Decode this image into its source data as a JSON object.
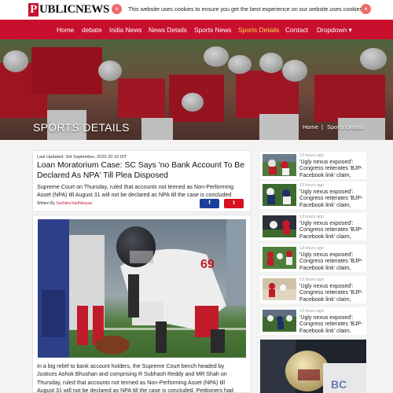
{
  "brand": {
    "logo_initial": "P",
    "logo_rest": "UBLICNEWS"
  },
  "cookie": {
    "close_left": "×",
    "text": "This website uses cookies to ensure you get the best experience on our website.uses cookies",
    "close_right": "×"
  },
  "nav": {
    "items": [
      "Home",
      "debate",
      "India News",
      "News Details",
      "Sports News",
      "Sports Details",
      "Contact",
      "Dropdown ▾"
    ],
    "active": "Sports Details"
  },
  "hero": {
    "title": "SPORTS DETAILS",
    "breadcrumb_home": "Home",
    "breadcrumb_sep": "|",
    "breadcrumb_current": "Sports Details"
  },
  "article": {
    "updated": "Last Updated: 3rd September, 2020 20:16 IST",
    "headline": "Loan Moratorium Case: SC Says 'no Bank Account To Be Declared As NPA' Till Plea Disposed",
    "summary": "Supreme Court on Thursday, ruled that accounts not termed as Non-Performing Asset (NPA) till August 31 will not be declared as NPA till the case is concluded",
    "written_by": "Written By",
    "author": "Suchitra Karthikeyan",
    "share_facebook": "f",
    "share_twitter": "t",
    "body": "In a big relief to bank account holders, the Supreme Court bench headed by Justices Ashok Bhushan and comprising R Subhash Reddy and MR Shah on Thursday, ruled that accounts not termed as Non-Performing Asset (NPA) till August 31 will not be declared as NPA till the case is concluded. Petitioners had"
  },
  "sidebar": {
    "items": [
      {
        "time": "13 hours ago",
        "title": "'Ugly nexus exposed': Congress reiterates 'BJP-Facebook link' claim,"
      },
      {
        "time": "13 hours ago",
        "title": "'Ugly nexus exposed': Congress reiterates 'BJP-Facebook link' claim,"
      },
      {
        "time": "13 hours ago",
        "title": "'Ugly nexus exposed': Congress reiterates 'BJP-Facebook link' claim,"
      },
      {
        "time": "13 hours ago",
        "title": "'Ugly nexus exposed': Congress reiterates 'BJP-Facebook link' claim,"
      },
      {
        "time": "13 hours ago",
        "title": "'Ugly nexus exposed': Congress reiterates 'BJP-Facebook link' claim,"
      },
      {
        "time": "13 hours ago",
        "title": "'Ugly nexus exposed': Congress reiterates 'BJP-Facebook link' claim,"
      }
    ]
  },
  "colors": {
    "brand_red": "#c8102e",
    "nav_active": "#ffd54a",
    "facebook": "#1d3f9c",
    "twitter": "#d8101e"
  }
}
